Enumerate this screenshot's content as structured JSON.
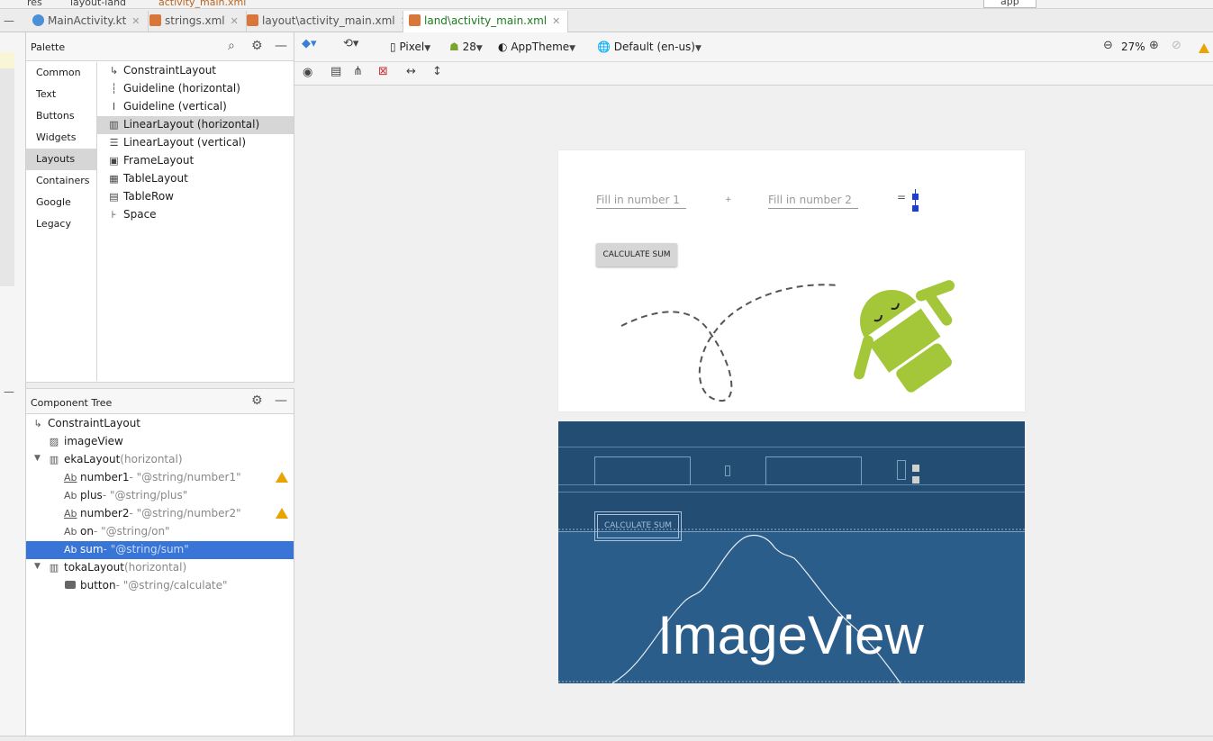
{
  "breadcrumb": [
    "res",
    "layout-land",
    "activity_main.xml"
  ],
  "tabs": [
    {
      "label": "MainActivity.kt",
      "color": "#4a90d9"
    },
    {
      "label": "strings.xml",
      "color": "#d9773a"
    },
    {
      "label": "layout\\activity_main.xml",
      "color": "#d9773a"
    },
    {
      "label": "land\\activity_main.xml",
      "color": "#d9773a"
    }
  ],
  "run_config": "app",
  "palette": {
    "title": "Palette",
    "categories": [
      "Common",
      "Text",
      "Buttons",
      "Widgets",
      "Layouts",
      "Containers",
      "Google",
      "Legacy"
    ],
    "selected_category": "Layouts",
    "items": [
      {
        "label": "ConstraintLayout",
        "icon": "constraint-icon"
      },
      {
        "label": "Guideline (horizontal)",
        "icon": "guideline-horizontal-icon"
      },
      {
        "label": "Guideline (vertical)",
        "icon": "guideline-vertical-icon"
      },
      {
        "label": "LinearLayout (horizontal)",
        "icon": "linear-horizontal-icon"
      },
      {
        "label": "LinearLayout (vertical)",
        "icon": "linear-vertical-icon"
      },
      {
        "label": "FrameLayout",
        "icon": "frame-icon"
      },
      {
        "label": "TableLayout",
        "icon": "table-icon"
      },
      {
        "label": "TableRow",
        "icon": "tablerow-icon"
      },
      {
        "label": "Space",
        "icon": "space-icon"
      }
    ]
  },
  "component_tree": {
    "title": "Component Tree",
    "rows": [
      {
        "name": "ConstraintLayout",
        "ref": "",
        "hint": "",
        "icon": "constraint-icon"
      },
      {
        "name": "imageView",
        "ref": "",
        "hint": "",
        "icon": "image-icon"
      },
      {
        "name": "ekaLayout",
        "ref": "",
        "hint": "(horizontal)",
        "icon": "linear-horizontal-icon"
      },
      {
        "name": "number1",
        "ref": "- \"@string/number1\"",
        "hint": "",
        "icon": "edittext-icon",
        "warning": true
      },
      {
        "name": "plus",
        "ref": "- \"@string/plus\"",
        "hint": "",
        "icon": "textview-icon"
      },
      {
        "name": "number2",
        "ref": "- \"@string/number2\"",
        "hint": "",
        "icon": "edittext-icon",
        "warning": true
      },
      {
        "name": "on",
        "ref": "- \"@string/on\"",
        "hint": "",
        "icon": "textview-icon"
      },
      {
        "name": "sum",
        "ref": "- \"@string/sum\"",
        "hint": "",
        "icon": "textview-icon"
      },
      {
        "name": "tokaLayout",
        "ref": "",
        "hint": "(horizontal)",
        "icon": "linear-horizontal-icon"
      },
      {
        "name": "button",
        "ref": "- \"@string/calculate\"",
        "hint": "",
        "icon": "button-icon"
      }
    ],
    "selected_row": "sum"
  },
  "toolbar": {
    "device": "Pixel",
    "api": "28",
    "theme": "AppTheme",
    "locale": "Default (en-us)",
    "zoom": "27%"
  },
  "design_preview": {
    "number1_hint": "Fill in number 1",
    "plus": "+",
    "number2_hint": "Fill in number 2",
    "equals": "=",
    "button": "CALCULATE SUM"
  },
  "blueprint": {
    "button": "CALCULATE SUM",
    "imageview_label": "ImageView"
  },
  "colors": {
    "selection": "#3875d7",
    "android_green": "#a4c639",
    "blueprint": "#2a5d8a",
    "warning": "#e8a400"
  }
}
